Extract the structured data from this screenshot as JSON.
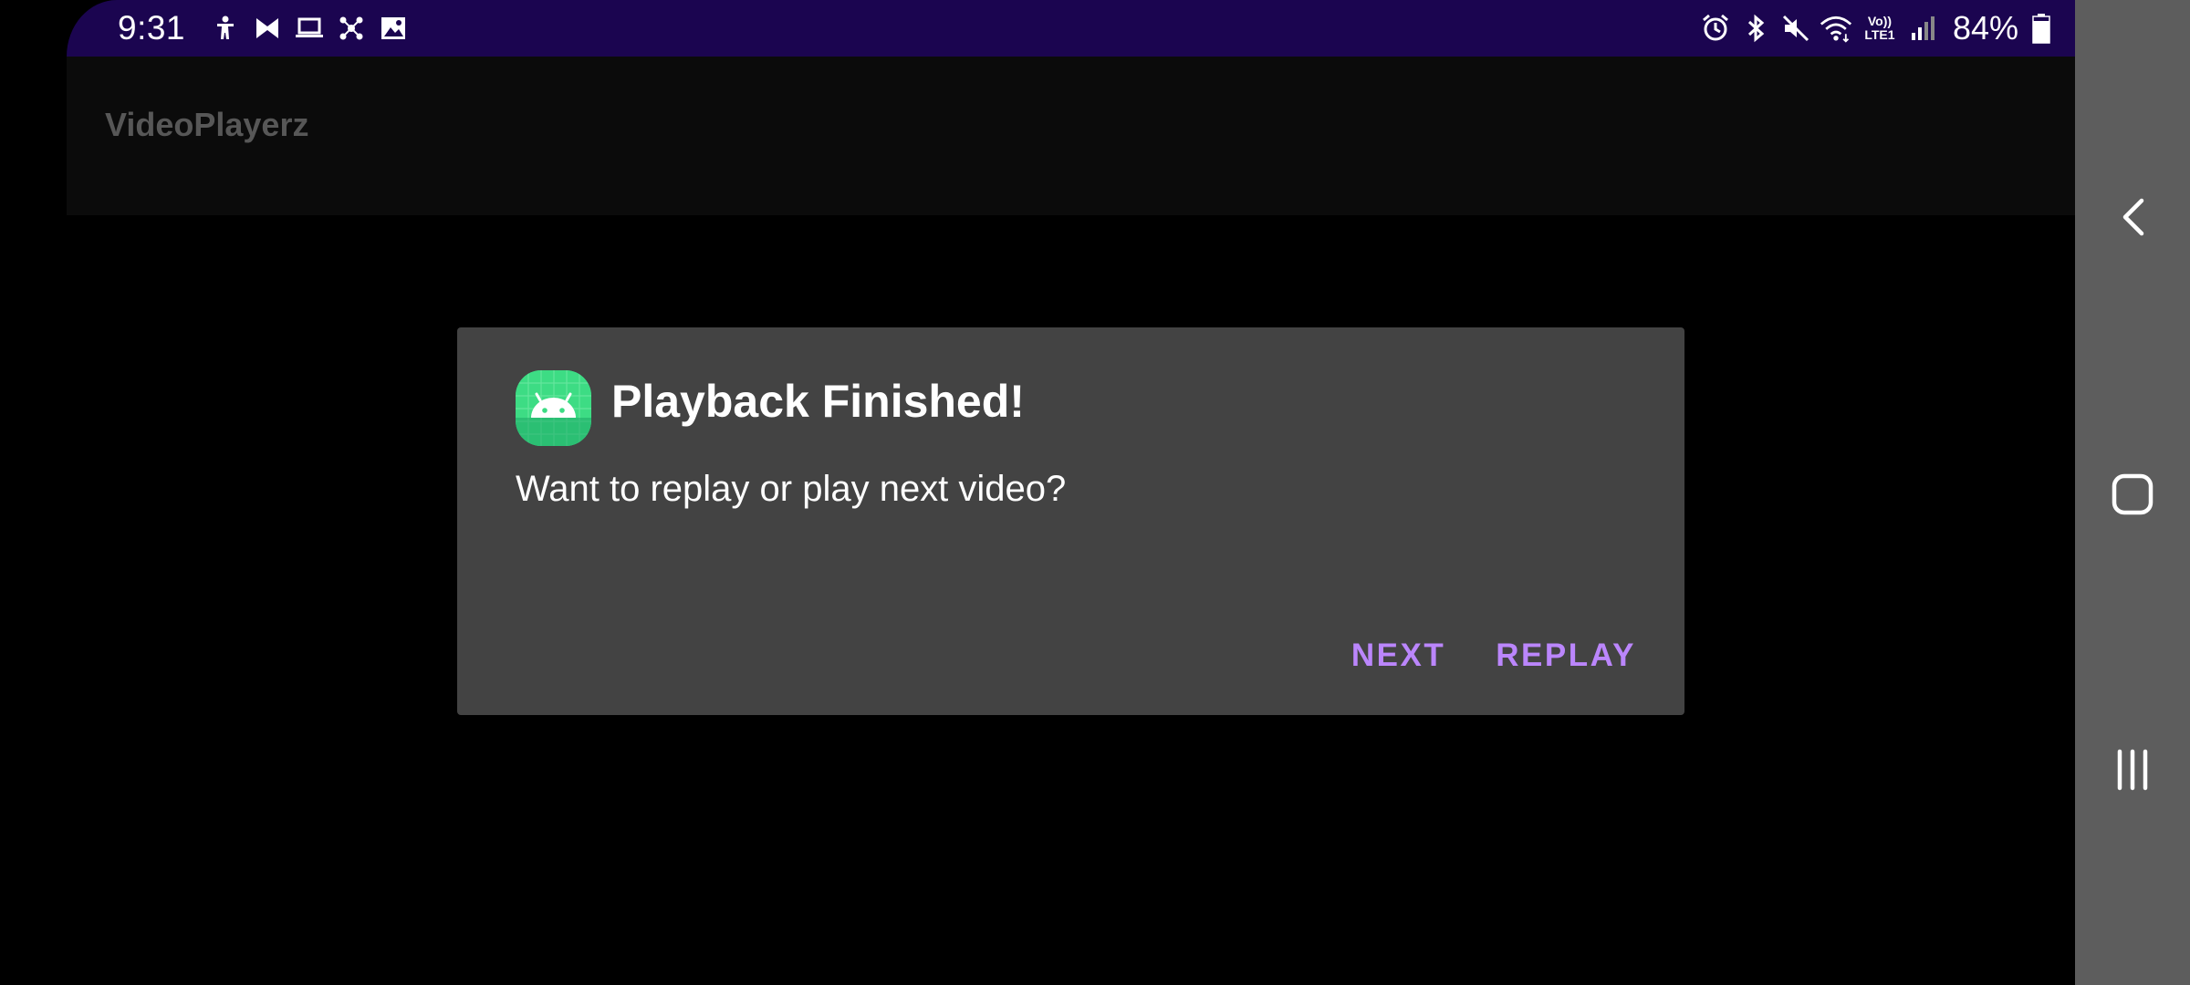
{
  "status_bar": {
    "time": "9:31",
    "left_icons": [
      "accessibility-icon",
      "mirror-icon",
      "laptop-icon",
      "network-hub-icon",
      "gallery-icon"
    ],
    "right_icons": [
      "alarm-icon",
      "bluetooth-icon",
      "mute-icon",
      "wifi-icon",
      "volte-icon",
      "signal-icon",
      "battery-icon"
    ],
    "volte_label_top": "Vo))",
    "volte_label_bottom": "LTE1",
    "battery_percent": "84%",
    "battery_level": 0.84,
    "background_color": "#1b0550"
  },
  "app_bar": {
    "title": "VideoPlayerz"
  },
  "dialog": {
    "icon": "android-app-icon",
    "title": "Playback Finished!",
    "message": "Want to replay or play next video?",
    "buttons": {
      "next": "NEXT",
      "replay": "REPLAY"
    },
    "accent_color": "#bb86fc",
    "background_color": "#434343"
  },
  "nav_bar": {
    "buttons": [
      "back-icon",
      "home-icon",
      "recents-icon"
    ],
    "background_color": "#5d5d5d"
  }
}
